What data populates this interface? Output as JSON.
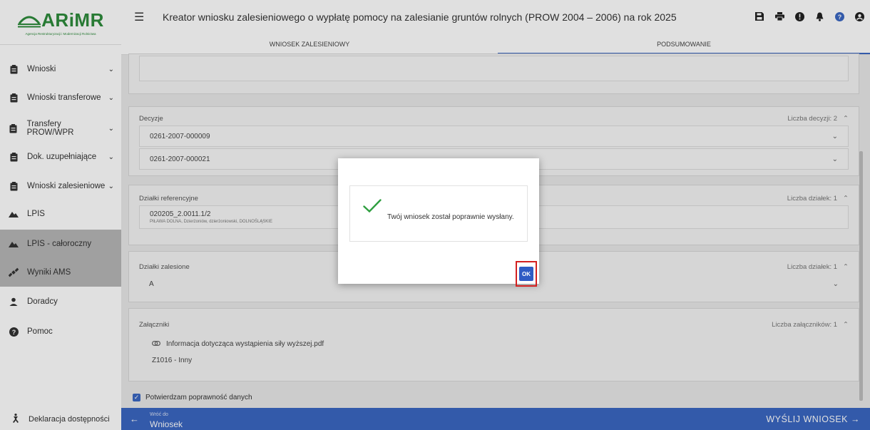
{
  "logo": {
    "main": "ARiMR",
    "sub": "Agencja Restrukturyzacji i Modernizacji Rolnictwa"
  },
  "sidebar": {
    "items": [
      {
        "label": "Wnioski",
        "icon": "clipboard-icon"
      },
      {
        "label": "Wnioski transferowe",
        "icon": "clipboard-icon"
      },
      {
        "label": "Transfery PROW/WPR",
        "icon": "clipboard-icon"
      },
      {
        "label": "Dok. uzupełniające",
        "icon": "clipboard-icon"
      },
      {
        "label": "Wnioski zalesieniowe",
        "icon": "clipboard-icon"
      },
      {
        "label": "LPIS",
        "icon": "mountain-icon"
      },
      {
        "label": "LPIS - całoroczny",
        "icon": "mountain-icon"
      },
      {
        "label": "Wyniki AMS",
        "icon": "satellite-icon"
      },
      {
        "label": "Doradcy",
        "icon": "person-icon"
      },
      {
        "label": "Pomoc",
        "icon": "help-icon"
      }
    ],
    "footer": "Deklaracja dostępności"
  },
  "header": {
    "title": "Kreator wniosku zalesieniowego o wypłatę pomocy na zalesianie gruntów rolnych (PROW 2004 – 2006) na rok 2025"
  },
  "tabs": [
    "WNIOSEK ZALESIENIOWY",
    "PODSUMOWANIE"
  ],
  "decisions": {
    "title": "Decyzje",
    "count": "Liczba decyzji: 2",
    "items": [
      "0261-2007-000009",
      "0261-2007-000021"
    ]
  },
  "ref_parcels": {
    "title": "Działki referencyjne",
    "count": "Liczba działek: 1",
    "id": "020205_2.0011.1/2",
    "location": "PIŁAWA DOLNA, Dzierżoniów, dzierżoniowski, DOLNOŚLĄSKIE"
  },
  "forest_parcels": {
    "title": "Działki zalesione",
    "count": "Liczba działek: 1",
    "item": "A"
  },
  "attachments": {
    "title": "Załączniki",
    "count": "Liczba załączników: 1",
    "file": "Informacja dotycząca wystąpienia siły wyższej.pdf",
    "type": "Z1016 - Inny"
  },
  "confirm": "Potwierdzam poprawność danych",
  "bottom": {
    "back_small": "Wróć do",
    "back_label": "Wniosek",
    "send": "WYŚLIJ WNIOSEK"
  },
  "modal": {
    "message": "Twój wniosek został poprawnie wysłany.",
    "ok": "OK"
  },
  "colors": {
    "brand": "#2e8b3c",
    "primary": "#3b67c2",
    "highlight": "#d32020"
  }
}
